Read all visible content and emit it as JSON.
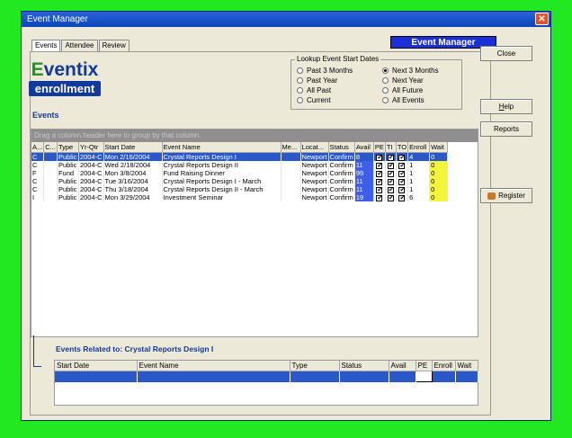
{
  "window": {
    "title": "Event Manager",
    "close_glyph": "✕"
  },
  "tabs": [
    "Events",
    "Attendee",
    "Review"
  ],
  "banner": "Event Manager",
  "logo": {
    "line1_a": "E",
    "line1_b": "ventix",
    "line2": "enrollment"
  },
  "events_label": "Events",
  "lookup": {
    "title": "Lookup Event Start Dates",
    "options": [
      {
        "label": "Past 3 Months",
        "selected": false
      },
      {
        "label": "Next 3 Months",
        "selected": true
      },
      {
        "label": "Past Year",
        "selected": false
      },
      {
        "label": "Next Year",
        "selected": false
      },
      {
        "label": "All Past",
        "selected": false
      },
      {
        "label": "All Future",
        "selected": false
      },
      {
        "label": "Current",
        "selected": false
      },
      {
        "label": "All Events",
        "selected": false
      }
    ]
  },
  "buttons": {
    "close": "Close",
    "help_u": "H",
    "help_rest": "elp",
    "reports": "Reports",
    "register": "Register"
  },
  "grid": {
    "group_hint": "Drag a column header here to group by that column.",
    "columns": [
      "A...",
      "C...",
      "Type",
      "Yr-Qtr",
      "Start Date",
      "Event Name",
      "Me...",
      "Locat...",
      "Status",
      "Avail",
      "PE",
      "TI",
      "TO",
      "Enroll",
      "Wait"
    ],
    "rows": [
      [
        "C",
        "",
        "Public",
        "2004-C",
        "Mon 2/16/2004",
        "Crystal Reports Design I",
        "",
        "Newport",
        "Confirm",
        "8",
        "✔",
        "✔",
        "✔",
        "4",
        "0"
      ],
      [
        "C",
        "",
        "Public",
        "2004-C",
        "Wed 2/18/2004",
        "Crystal Reports Design II",
        "",
        "Newport",
        "Confirm",
        "11",
        "✔",
        "✔",
        "✔",
        "1",
        "0"
      ],
      [
        "F",
        "",
        "Fund",
        "2004-C",
        "Mon 3/8/2004",
        "Fund Raising Dinner",
        "",
        "Newport",
        "Confirm",
        "99",
        "✔",
        "✔",
        "✔",
        "1",
        "0"
      ],
      [
        "C",
        "",
        "Public",
        "2004-C",
        "Tue 3/16/2004",
        "Crystal Reports Design I - March",
        "",
        "Newport",
        "Confirm",
        "11",
        "✔",
        "✔",
        "✔",
        "1",
        "0"
      ],
      [
        "C",
        "",
        "Public",
        "2004-C",
        "Thu 3/18/2004",
        "Crystal Reports Design II - March",
        "",
        "Newport",
        "Confirm",
        "11",
        "✔",
        "✔",
        "✔",
        "1",
        "0"
      ],
      [
        "I",
        "",
        "Public",
        "2004-C",
        "Mon 3/29/2004",
        "Investment Seminar",
        "",
        "Newport",
        "Confirm",
        "19",
        "✔",
        "✔",
        "✔",
        "6",
        "0"
      ]
    ]
  },
  "related": {
    "title": "Events Related to: Crystal Reports Design I",
    "columns": [
      "Start Date",
      "Event Name",
      "Type",
      "Status",
      "Avail",
      "PE",
      "Enroll",
      "Wait"
    ]
  },
  "colors": {
    "selection": "#2a58c8",
    "avail": "#3f5fe8",
    "wait": "#f4f43a",
    "banner": "#1a2fd6"
  }
}
